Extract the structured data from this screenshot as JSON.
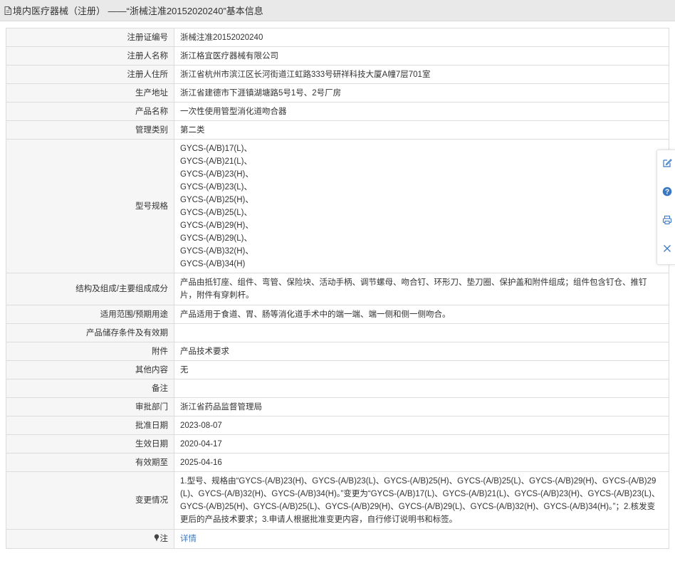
{
  "header": {
    "title": "境内医疗器械（注册） ——“浙械注准20152020240”基本信息"
  },
  "rows": [
    {
      "label": "注册证编号",
      "value": "浙械注准20152020240"
    },
    {
      "label": "注册人名称",
      "value": "浙江格宜医疗器械有限公司"
    },
    {
      "label": "注册人住所",
      "value": "浙江省杭州市滨江区长河街道江虹路333号研祥科技大厦A幢7层701室"
    },
    {
      "label": "生产地址",
      "value": "浙江省建德市下涯镇湖塘路5号1号、2号厂房"
    },
    {
      "label": "产品名称",
      "value": "一次性使用管型消化道吻合器"
    },
    {
      "label": "管理类别",
      "value": "第二类"
    }
  ],
  "models": {
    "label": "型号规格",
    "lines": [
      "GYCS-(A/B)17(L)、",
      "GYCS-(A/B)21(L)、",
      "GYCS-(A/B)23(H)、",
      "GYCS-(A/B)23(L)、",
      "GYCS-(A/B)25(H)、",
      "GYCS-(A/B)25(L)、",
      "GYCS-(A/B)29(H)、",
      "GYCS-(A/B)29(L)、",
      "GYCS-(A/B)32(H)、",
      "GYCS-(A/B)34(H)"
    ]
  },
  "rows2": [
    {
      "label": "结构及组成/主要组成成分",
      "value": "产品由抵钉座、组件、弯管、保险块、活动手柄、调节螺母、吻合钉、环形刀、垫刀圈、保护盖和附件组成；组件包含钉仓、推钉片，附件有穿刺杆。"
    },
    {
      "label": "适用范围/预期用途",
      "value": "产品适用于食道、胃、肠等消化道手术中的端一端、端一侧和侧一侧吻合。"
    },
    {
      "label": "产品储存条件及有效期",
      "value": ""
    },
    {
      "label": "附件",
      "value": "产品技术要求"
    },
    {
      "label": "其他内容",
      "value": "无"
    },
    {
      "label": "备注",
      "value": ""
    },
    {
      "label": "审批部门",
      "value": "浙江省药品监督管理局"
    },
    {
      "label": "批准日期",
      "value": "2023-08-07"
    },
    {
      "label": "生效日期",
      "value": "2020-04-17"
    },
    {
      "label": "有效期至",
      "value": "2025-04-16"
    },
    {
      "label": "变更情况",
      "value": "1.型号、规格由“GYCS-(A/B)23(H)、GYCS-(A/B)23(L)、GYCS-(A/B)25(H)、GYCS-(A/B)25(L)、GYCS-(A/B)29(H)、GYCS-(A/B)29(L)、GYCS-(A/B)32(H)、GYCS-(A/B)34(H)。”变更为“GYCS-(A/B)17(L)、GYCS-(A/B)21(L)、GYCS-(A/B)23(H)、GYCS-(A/B)23(L)、GYCS-(A/B)25(H)、GYCS-(A/B)25(L)、GYCS-(A/B)29(H)、GYCS-(A/B)29(L)、GYCS-(A/B)32(H)、GYCS-(A/B)34(H)。”；2.核发变更后的产品技术要求；3.申请人根据批准变更内容，自行修订说明书和标签。"
    }
  ],
  "note_row": {
    "label": "注",
    "link_text": "详情"
  },
  "sidebar": {
    "icons": [
      "edit-icon",
      "help-icon",
      "print-icon",
      "close-icon"
    ]
  },
  "colors": {
    "title_bg": "#e9e9e9",
    "label_bg": "#f6f6f6",
    "border": "#dcdcdc",
    "link": "#3b78c3",
    "accent": "#3b78c3"
  }
}
